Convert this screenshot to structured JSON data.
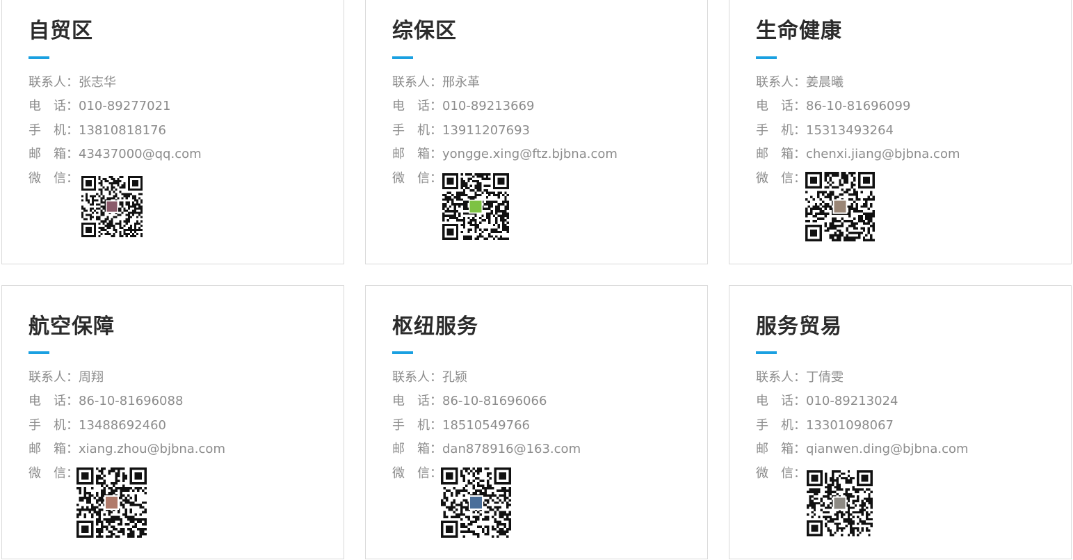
{
  "labels": {
    "contact": "联系人：",
    "tel": "电　话：",
    "mobile": "手　机：",
    "email": "邮　箱：",
    "wechat": "微　信："
  },
  "colors": {
    "accent": "#1aa0e1",
    "title": "#2b2b2b",
    "text": "#8c8c8c",
    "border": "#d9d9d9"
  },
  "cards": [
    {
      "title": "自贸区",
      "contact": "张志华",
      "tel": "010-89277021",
      "mobile": "13810818176",
      "email": "43437000@qq.com",
      "qr_icon": "wechat-qr-code-icon"
    },
    {
      "title": "综保区",
      "contact": "邢永革",
      "tel": "010-89213669",
      "mobile": "13911207693",
      "email": "yongge.xing@ftz.bjbna.com",
      "qr_icon": "wechat-qr-code-icon"
    },
    {
      "title": "生命健康",
      "contact": "姜晨曦",
      "tel": "86-10-81696099",
      "mobile": "15313493264",
      "email": "chenxi.jiang@bjbna.com",
      "qr_icon": "wechat-qr-code-icon"
    },
    {
      "title": "航空保障",
      "contact": "周翔",
      "tel": "86-10-81696088",
      "mobile": "13488692460",
      "email": "xiang.zhou@bjbna.com",
      "qr_icon": "wechat-qr-code-icon"
    },
    {
      "title": "枢纽服务",
      "contact": "孔颍",
      "tel": "86-10-81696066",
      "mobile": "18510549766",
      "email": "dan878916@163.com",
      "qr_icon": "wechat-qr-code-icon"
    },
    {
      "title": "服务贸易",
      "contact": "丁倩雯",
      "tel": "010-89213024",
      "mobile": "13301098067",
      "email": "qianwen.ding@bjbna.com",
      "qr_icon": "wechat-qr-code-icon"
    }
  ]
}
